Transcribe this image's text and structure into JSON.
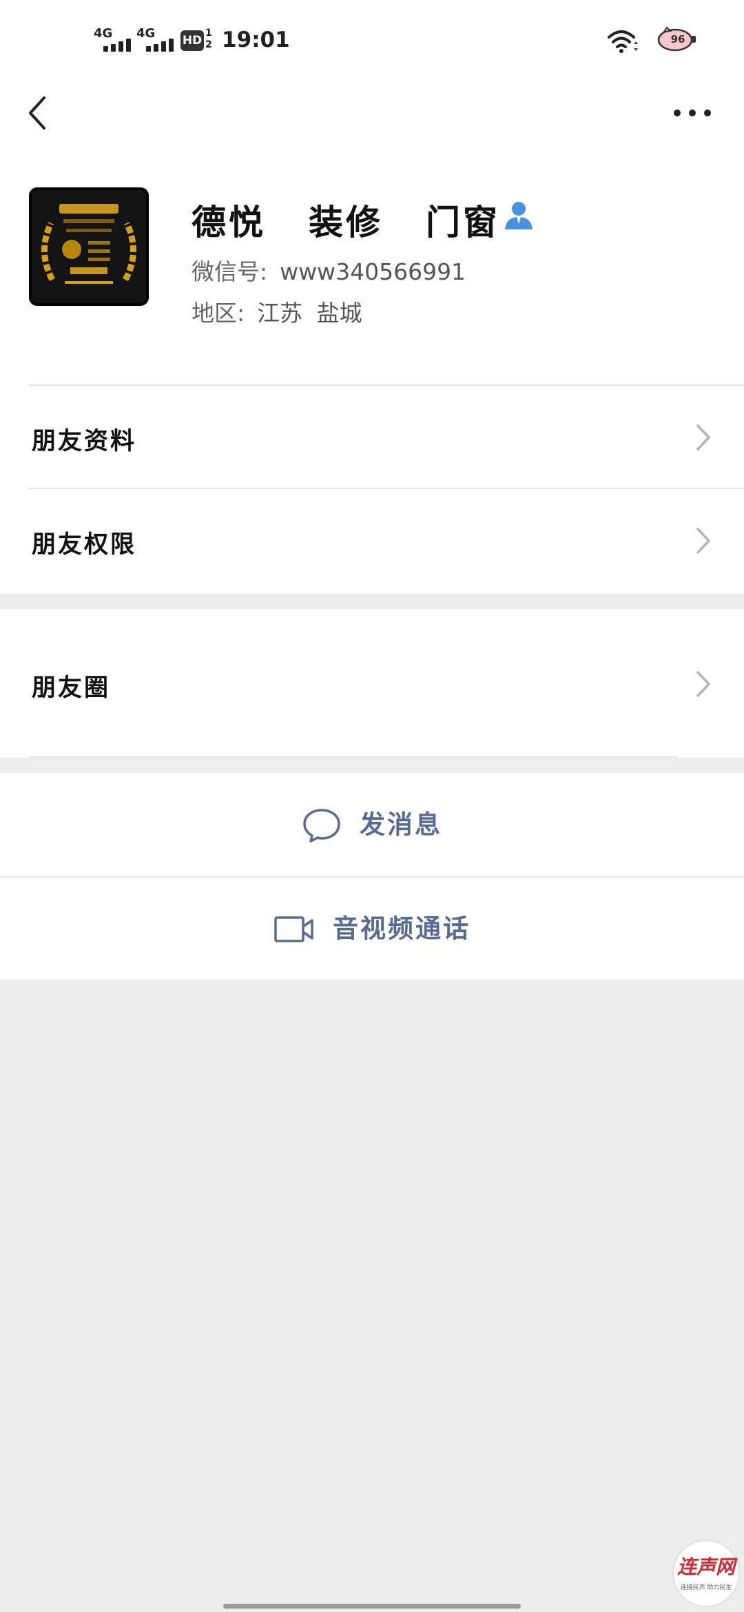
{
  "status_bar": {
    "sim1": "4G",
    "sim2": "4G",
    "hd": "HD",
    "hd_num": "1\n2",
    "time": "19:01",
    "battery": "96"
  },
  "profile": {
    "name_parts": [
      "德悦",
      "装修",
      "门窗"
    ],
    "wechat_id_label": "微信号:",
    "wechat_id": "www340566991",
    "region_label": "地区:",
    "region": "江苏 盐城"
  },
  "menu": [
    {
      "label": "朋友资料"
    },
    {
      "label": "朋友权限"
    },
    {
      "label": "朋友圈"
    }
  ],
  "actions": {
    "message": "发消息",
    "call": "音视频通话"
  },
  "watermark": {
    "main": "连声网",
    "sub": "连接民声 助力民生"
  },
  "colors": {
    "link": "#576b95",
    "background": "#ededed",
    "verify_icon": "#4a90e2"
  }
}
